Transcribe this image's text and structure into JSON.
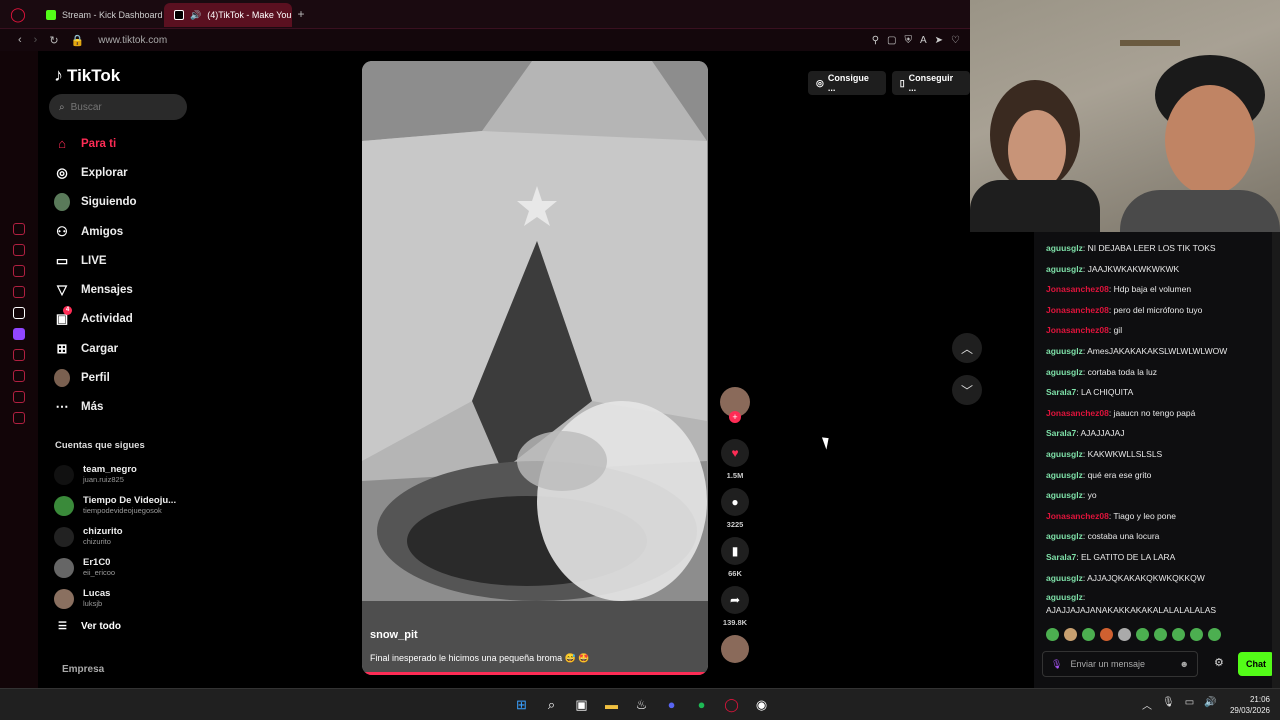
{
  "browser": {
    "tabs": [
      {
        "label": "Stream - Kick Dashboard",
        "active": false
      },
      {
        "label": "(4)TikTok - Make You",
        "active": true
      }
    ],
    "new_tab": "+",
    "url": "www.tiktok.com"
  },
  "tiktok": {
    "logo": "TikTok",
    "search_placeholder": "Buscar",
    "menu": [
      {
        "label": "Para ti",
        "icon": "home-icon",
        "active": true
      },
      {
        "label": "Explorar",
        "icon": "compass-icon"
      },
      {
        "label": "Siguiendo",
        "icon": "following-avatar-icon"
      },
      {
        "label": "Amigos",
        "icon": "friends-icon"
      },
      {
        "label": "LIVE",
        "icon": "live-icon"
      },
      {
        "label": "Mensajes",
        "icon": "send-icon"
      },
      {
        "label": "Actividad",
        "icon": "inbox-icon",
        "badge": "4"
      },
      {
        "label": "Cargar",
        "icon": "upload-icon"
      },
      {
        "label": "Perfil",
        "icon": "profile-icon"
      },
      {
        "label": "Más",
        "icon": "more-icon"
      }
    ],
    "following_title": "Cuentas que sigues",
    "following": [
      {
        "name": "team_negro",
        "handle": "juan.ruiz825"
      },
      {
        "name": "Tiempo De Videoju...",
        "handle": "tiempodevideojuegosok"
      },
      {
        "name": "chizurito",
        "handle": "chizurito"
      },
      {
        "name": "Er1C0",
        "handle": "eii_ericoo"
      },
      {
        "name": "Lucas",
        "handle": "luksjb"
      }
    ],
    "see_all": "Ver todo",
    "footer": "Empresa",
    "top_buttons": [
      "Consigue ...",
      "Conseguir ..."
    ],
    "video": {
      "username": "snow_pit",
      "caption": "Final inesperado le hicimos una pequeña broma 😅 🤩"
    },
    "actions": {
      "likes": "1.5M",
      "comments": "3225",
      "saves": "66K",
      "shares": "139.8K"
    }
  },
  "chat": {
    "colors": {
      "aguus": "#7ee0a8",
      "jona": "#e0143c",
      "sara": "#7ee0a8"
    },
    "messages": [
      {
        "user": "aguusglz",
        "text": "NI DEJABA LEER LOS TIK TOKS",
        "c": "aguus"
      },
      {
        "user": "aguusglz",
        "text": "JAAJKWKAKWKWKWK",
        "c": "aguus"
      },
      {
        "user": "Jonasanchez08",
        "text": "Hdp baja el volumen",
        "c": "jona"
      },
      {
        "user": "Jonasanchez08",
        "text": "pero del micrófono tuyo",
        "c": "jona"
      },
      {
        "user": "Jonasanchez08",
        "text": "gil",
        "c": "jona"
      },
      {
        "user": "aguusglz",
        "text": "AmesJAKAKAKAKSLWLWLWLWOW",
        "c": "aguus"
      },
      {
        "user": "aguusglz",
        "text": "cortaba toda la luz",
        "c": "aguus"
      },
      {
        "user": "Sarala7",
        "text": "LA CHIQUITA",
        "c": "sara"
      },
      {
        "user": "Jonasanchez08",
        "text": "jaaucn no tengo papá",
        "c": "jona"
      },
      {
        "user": "Sarala7",
        "text": "AJAJJAJAJ",
        "c": "sara"
      },
      {
        "user": "aguusglz",
        "text": "KAKWKWLLSLSLS",
        "c": "aguus"
      },
      {
        "user": "aguusglz",
        "text": "qué era ese grito",
        "c": "aguus"
      },
      {
        "user": "aguusglz",
        "text": "yo",
        "c": "aguus"
      },
      {
        "user": "Jonasanchez08",
        "text": "Tiago y leo pone",
        "c": "jona"
      },
      {
        "user": "aguusglz",
        "text": "costaba una locura",
        "c": "aguus"
      },
      {
        "user": "Sarala7",
        "text": "EL GATITO DE LA LARA",
        "c": "sara"
      },
      {
        "user": "aguusglz",
        "text": "AJJAJQKAKAKQKWKQKKQW",
        "c": "aguus"
      },
      {
        "user": "aguusglz",
        "text": "AJAJJAJAJANAKAKKAKAKALALALALALAS",
        "c": "aguus",
        "wrap": true
      }
    ],
    "input_placeholder": "Enviar un mensaje",
    "send_label": "Chat"
  },
  "taskbar": {
    "time": "21:06",
    "date": "29/03/2026"
  }
}
